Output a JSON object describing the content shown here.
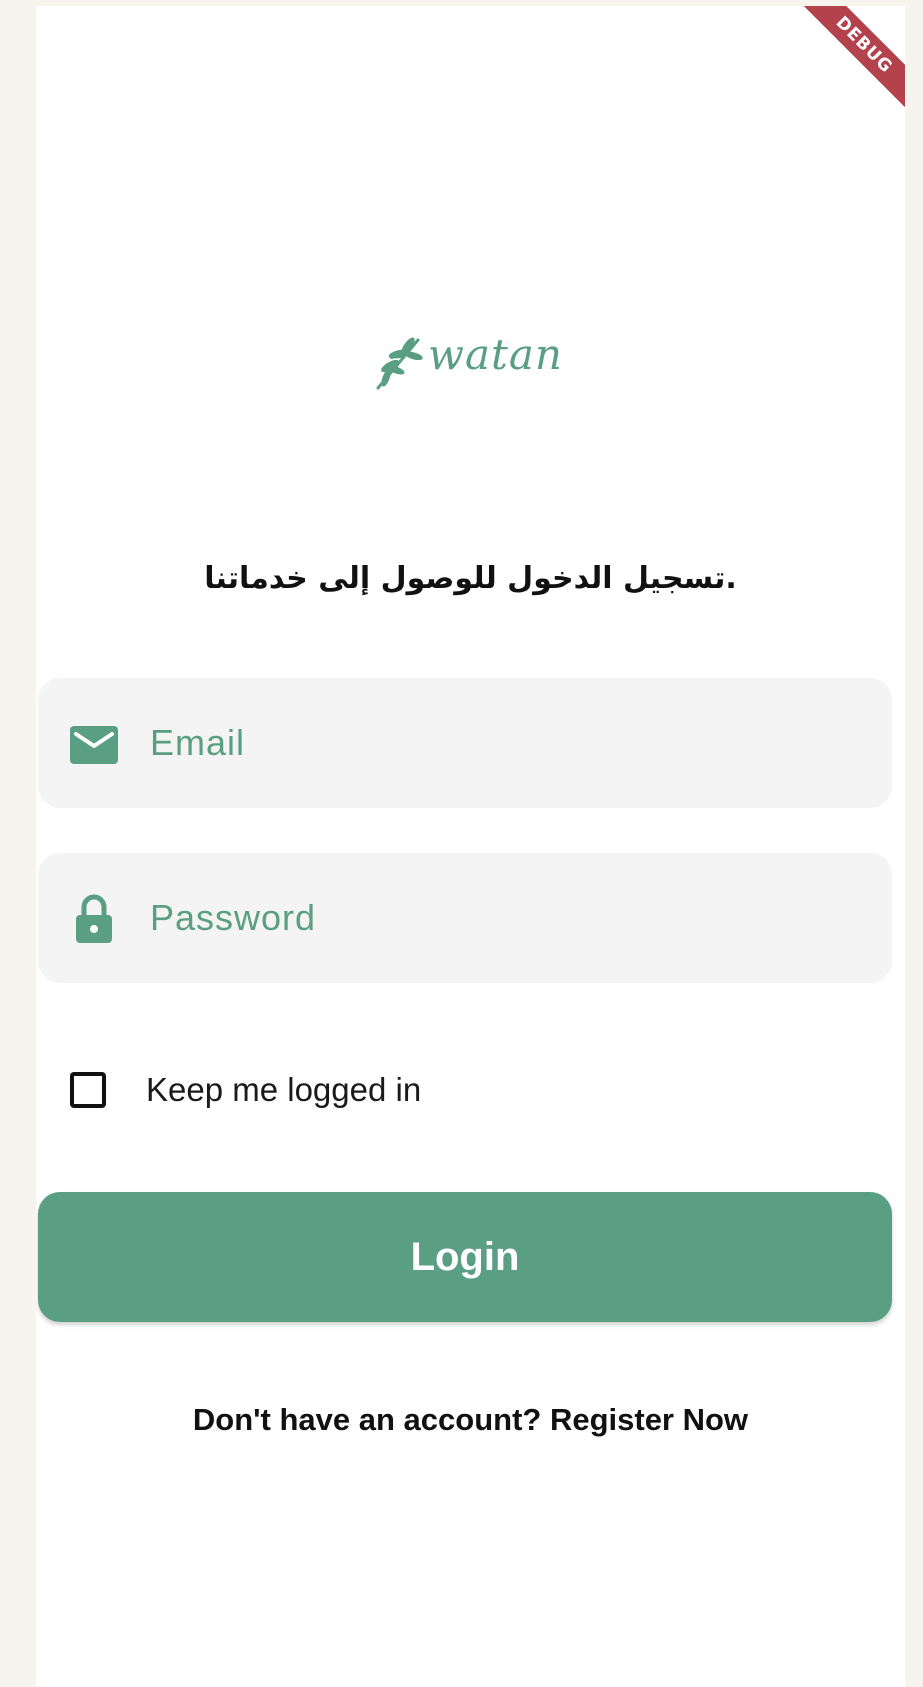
{
  "debug_banner": "DEBUG",
  "logo": {
    "text": "watan",
    "icon": "olive-branch-icon",
    "color": "#5a9e84"
  },
  "subtitle": ".تسجيل الدخول للوصول إلى خدماتنا",
  "email_field": {
    "placeholder": "Email",
    "icon": "mail-icon"
  },
  "password_field": {
    "placeholder": "Password",
    "icon": "lock-icon"
  },
  "remember": {
    "label": "Keep me logged in",
    "checked": false
  },
  "login_button": {
    "label": "Login",
    "color": "#5a9e84"
  },
  "register": {
    "prompt": "Don't have an account?",
    "link": "Register Now"
  }
}
